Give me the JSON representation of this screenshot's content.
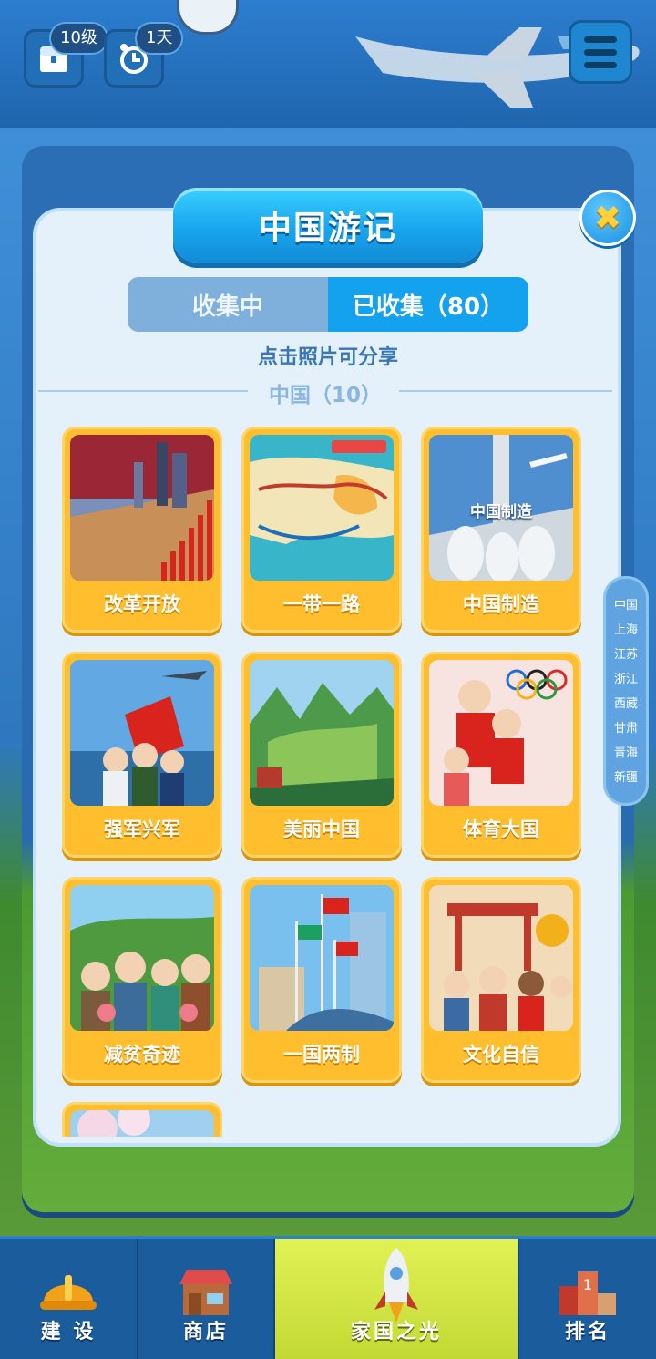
{
  "top_bar": {
    "level_badge": "10级",
    "days_badge": "1天",
    "icons": [
      "chest-icon",
      "alarm-clock-icon",
      "menu-icon"
    ]
  },
  "modal": {
    "title": "中国游记",
    "tabs": [
      {
        "label": "收集中",
        "active": false
      },
      {
        "label": "已收集（80）",
        "active": true
      }
    ],
    "hint": "点击照片可分享",
    "section_label": "中国（10）",
    "cards": [
      {
        "label": "改革开放",
        "image": "reform-opening-photo"
      },
      {
        "label": "一带一路",
        "image": "belt-road-map-photo"
      },
      {
        "label": "中国制造",
        "image": "made-in-china-photo",
        "overlay_text": "中国制造"
      },
      {
        "label": "强军兴军",
        "image": "military-photo"
      },
      {
        "label": "美丽中国",
        "image": "beautiful-china-photo"
      },
      {
        "label": "体育大国",
        "image": "sports-photo"
      },
      {
        "label": "减贫奇迹",
        "image": "poverty-alleviation-photo"
      },
      {
        "label": "一国两制",
        "image": "one-country-two-systems-photo"
      },
      {
        "label": "文化自信",
        "image": "cultural-confidence-photo"
      },
      {
        "label": "",
        "image": "partial-blossom-photo"
      }
    ]
  },
  "side_index": [
    "中国",
    "上海",
    "江苏",
    "浙江",
    "西藏",
    "甘肃",
    "青海",
    "新疆"
  ],
  "bottom_nav": [
    {
      "label": "建 设",
      "icon": "hard-hat-icon",
      "active": false
    },
    {
      "label": "商店",
      "icon": "shop-icon",
      "active": false
    },
    {
      "label": "家国之光",
      "icon": "rocket-icon",
      "active": true
    },
    {
      "label": "排名",
      "icon": "podium-icon",
      "active": false
    }
  ]
}
